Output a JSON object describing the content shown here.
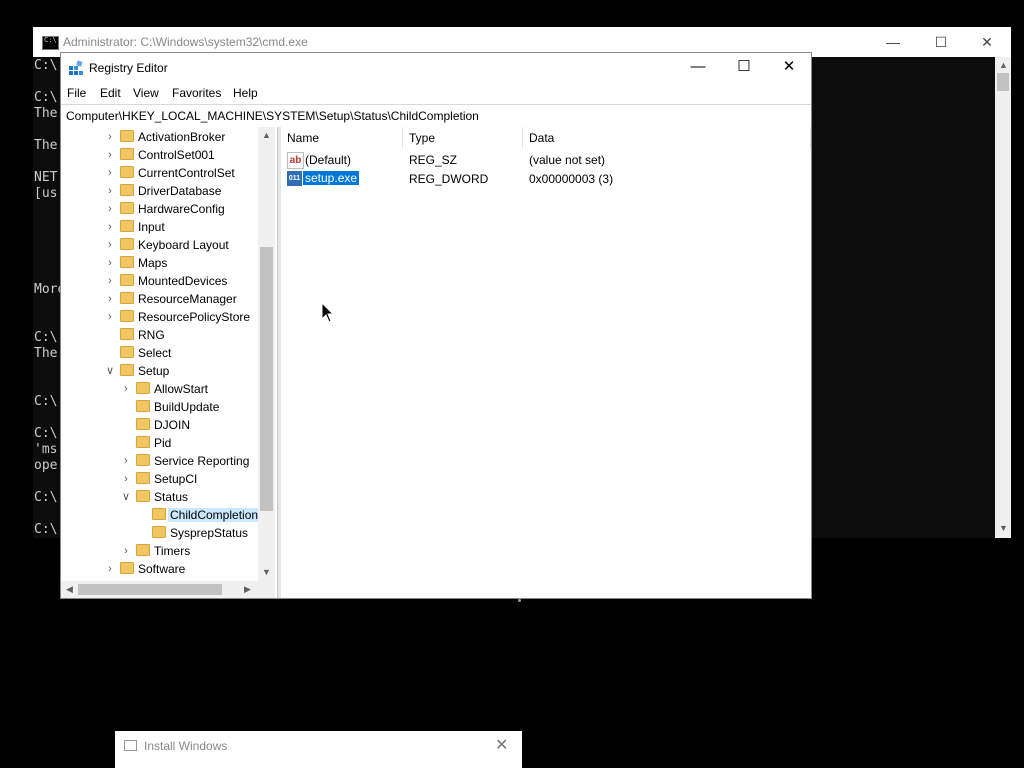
{
  "cmd": {
    "title": "Administrator: C:\\Windows\\system32\\cmd.exe",
    "lines": [
      "C:\\",
      "C:\\",
      "The",
      "The",
      "NET",
      "[us",
      "More",
      "C:\\",
      "The",
      "C:\\",
      "C:\\",
      "'ms",
      "ope",
      "C:\\",
      "C:\\"
    ],
    "minimize": "—",
    "maximize": "☐",
    "close": "✕"
  },
  "regedit": {
    "title": "Registry Editor",
    "minimize": "—",
    "maximize": "☐",
    "close": "✕",
    "menu": [
      "File",
      "Edit",
      "View",
      "Favorites",
      "Help"
    ],
    "address": "Computer\\HKEY_LOCAL_MACHINE\\SYSTEM\\Setup\\Status\\ChildCompletion",
    "tree": [
      {
        "label": "ActivationBroker",
        "exp": ">",
        "level": 0
      },
      {
        "label": "ControlSet001",
        "exp": ">",
        "level": 0
      },
      {
        "label": "CurrentControlSet",
        "exp": ">",
        "level": 0
      },
      {
        "label": "DriverDatabase",
        "exp": ">",
        "level": 0
      },
      {
        "label": "HardwareConfig",
        "exp": ">",
        "level": 0
      },
      {
        "label": "Input",
        "exp": ">",
        "level": 0
      },
      {
        "label": "Keyboard Layout",
        "exp": ">",
        "level": 0
      },
      {
        "label": "Maps",
        "exp": ">",
        "level": 0
      },
      {
        "label": "MountedDevices",
        "exp": ">",
        "level": 0
      },
      {
        "label": "ResourceManager",
        "exp": ">",
        "level": 0
      },
      {
        "label": "ResourcePolicyStore",
        "exp": ">",
        "level": 0
      },
      {
        "label": "RNG",
        "exp": "",
        "level": 0
      },
      {
        "label": "Select",
        "exp": "",
        "level": 0
      },
      {
        "label": "Setup",
        "exp": "v",
        "level": 0
      },
      {
        "label": "AllowStart",
        "exp": ">",
        "level": 1
      },
      {
        "label": "BuildUpdate",
        "exp": "",
        "level": 1
      },
      {
        "label": "DJOIN",
        "exp": "",
        "level": 1
      },
      {
        "label": "Pid",
        "exp": "",
        "level": 1
      },
      {
        "label": "Service Reporting",
        "exp": ">",
        "level": 1
      },
      {
        "label": "SetupCI",
        "exp": ">",
        "level": 1
      },
      {
        "label": "Status",
        "exp": "v",
        "level": 1
      },
      {
        "label": "ChildCompletion",
        "exp": "",
        "level": 2,
        "selected": true
      },
      {
        "label": "SysprepStatus",
        "exp": "",
        "level": 2
      },
      {
        "label": "Timers",
        "exp": ">",
        "level": 1
      },
      {
        "label": "Software",
        "exp": ">",
        "level": 0
      }
    ],
    "columns": {
      "name": "Name",
      "type": "Type",
      "data": "Data"
    },
    "values": [
      {
        "icon": "string-value-icon",
        "icon_text": "ab",
        "name": "(Default)",
        "type": "REG_SZ",
        "data": "(value not set)"
      },
      {
        "icon": "dword-value-icon",
        "icon_text": "011",
        "name": "setup.exe",
        "type": "REG_DWORD",
        "data": "0x00000003 (3)",
        "selected": true
      }
    ]
  },
  "install_windows": {
    "title": "Install Windows",
    "close": "✕"
  }
}
